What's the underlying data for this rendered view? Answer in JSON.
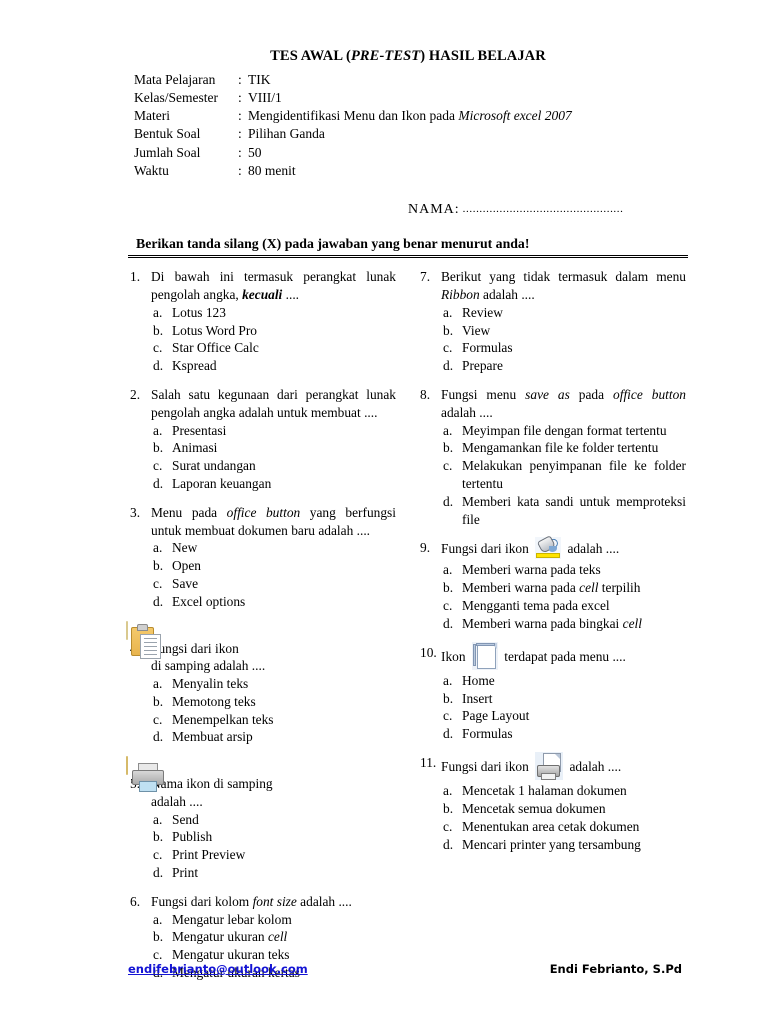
{
  "document": {
    "title_main": "TES AWAL (",
    "title_italic": "PRE-TEST",
    "title_end": ") HASIL BELAJAR",
    "meta": [
      {
        "label": "Mata Pelajaran",
        "colon": ":",
        "value": "TIK",
        "value_italic": ""
      },
      {
        "label": "Kelas/Semester",
        "colon": ":",
        "value": "VIII/1",
        "value_italic": ""
      },
      {
        "label": "Materi",
        "colon": ":",
        "value": "Mengidentifikasi Menu dan Ikon pada ",
        "value_italic": "Microsoft excel 2007"
      },
      {
        "label": "Bentuk Soal",
        "colon": ":",
        "value": "Pilihan Ganda",
        "value_italic": ""
      },
      {
        "label": "Jumlah Soal",
        "colon": ":",
        "value": "50",
        "value_italic": ""
      },
      {
        "label": "Waktu",
        "colon": ":",
        "value": "80 menit",
        "value_italic": ""
      }
    ],
    "nama_label": "NAMA",
    "nama_dots": "................................................",
    "instruction": "Berikan tanda silang (X) pada jawaban yang benar menurut anda!"
  },
  "left_column": [
    {
      "number": "1.",
      "text_parts": [
        {
          "t": "Di bawah ini termasuk perangkat lunak pengolah angka, ",
          "style": "normal"
        },
        {
          "t": "kecuali",
          "style": "bolditalic"
        },
        {
          "t": " ....",
          "style": "normal"
        }
      ],
      "justify": true,
      "icon": "",
      "options": [
        {
          "letter": "a.",
          "parts": [
            {
              "t": "Lotus 123",
              "style": "normal"
            }
          ]
        },
        {
          "letter": "b.",
          "parts": [
            {
              "t": "Lotus Word Pro",
              "style": "normal"
            }
          ]
        },
        {
          "letter": "c.",
          "parts": [
            {
              "t": "Star Office Calc",
              "style": "normal"
            }
          ]
        },
        {
          "letter": "d.",
          "parts": [
            {
              "t": "Kspread",
              "style": "normal"
            }
          ]
        }
      ]
    },
    {
      "number": "2.",
      "text_parts": [
        {
          "t": "Salah satu kegunaan dari perangkat lunak pengolah angka adalah untuk membuat ....",
          "style": "normal"
        }
      ],
      "justify": true,
      "icon": "",
      "options": [
        {
          "letter": "a.",
          "parts": [
            {
              "t": "Presentasi",
              "style": "normal"
            }
          ]
        },
        {
          "letter": "b.",
          "parts": [
            {
              "t": "Animasi",
              "style": "normal"
            }
          ]
        },
        {
          "letter": "c.",
          "parts": [
            {
              "t": "Surat undangan",
              "style": "normal"
            }
          ]
        },
        {
          "letter": "d.",
          "parts": [
            {
              "t": "Laporan keuangan",
              "style": "normal"
            }
          ]
        }
      ]
    },
    {
      "number": "3.",
      "text_parts": [
        {
          "t": "Menu pada ",
          "style": "normal"
        },
        {
          "t": "office button",
          "style": "italic"
        },
        {
          "t": " yang berfungsi untuk membuat dokumen baru adalah ....",
          "style": "normal"
        }
      ],
      "justify": true,
      "icon": "",
      "options": [
        {
          "letter": "a.",
          "parts": [
            {
              "t": "New",
              "style": "normal"
            }
          ]
        },
        {
          "letter": "b.",
          "parts": [
            {
              "t": "Open",
              "style": "normal"
            }
          ]
        },
        {
          "letter": "c.",
          "parts": [
            {
              "t": "Save",
              "style": "normal"
            }
          ]
        },
        {
          "letter": "d.",
          "parts": [
            {
              "t": "Excel options",
              "style": "normal"
            }
          ]
        }
      ]
    },
    {
      "number": "4.",
      "text_parts": [
        {
          "t": "Fungsi dari ikon",
          "style": "normal"
        },
        {
          "t": "\nBREAK",
          "style": "break"
        },
        {
          "t": "di samping adalah ....",
          "style": "normal"
        }
      ],
      "justify": false,
      "icon": "paste-icon",
      "options": [
        {
          "letter": "a.",
          "parts": [
            {
              "t": "Menyalin teks",
              "style": "normal"
            }
          ]
        },
        {
          "letter": "b.",
          "parts": [
            {
              "t": "Memotong teks",
              "style": "normal"
            }
          ]
        },
        {
          "letter": "c.",
          "parts": [
            {
              "t": "Menempelkan teks",
              "style": "normal"
            }
          ]
        },
        {
          "letter": "d.",
          "parts": [
            {
              "t": "Membuat arsip",
              "style": "normal"
            }
          ]
        }
      ]
    },
    {
      "number": "5.",
      "text_parts": [
        {
          "t": "Nama ikon di samping",
          "style": "normal"
        },
        {
          "t": "\nBREAK",
          "style": "break"
        },
        {
          "t": "adalah ....",
          "style": "normal"
        }
      ],
      "justify": false,
      "icon": "printer-icon",
      "options": [
        {
          "letter": "a.",
          "parts": [
            {
              "t": "Send",
              "style": "normal"
            }
          ]
        },
        {
          "letter": "b.",
          "parts": [
            {
              "t": "Publish",
              "style": "normal"
            }
          ]
        },
        {
          "letter": "c.",
          "parts": [
            {
              "t": "Print Preview",
              "style": "normal"
            }
          ]
        },
        {
          "letter": "d.",
          "parts": [
            {
              "t": "Print",
              "style": "normal"
            }
          ]
        }
      ]
    },
    {
      "number": "6.",
      "text_parts": [
        {
          "t": "Fungsi dari kolom ",
          "style": "normal"
        },
        {
          "t": "font size",
          "style": "italic"
        },
        {
          "t": " adalah ....",
          "style": "normal"
        }
      ],
      "justify": false,
      "icon": "",
      "options": [
        {
          "letter": "a.",
          "parts": [
            {
              "t": "Mengatur lebar kolom",
              "style": "normal"
            }
          ]
        },
        {
          "letter": "b.",
          "parts": [
            {
              "t": "Mengatur ukuran ",
              "style": "normal"
            },
            {
              "t": "cell",
              "style": "italic"
            }
          ]
        },
        {
          "letter": "c.",
          "parts": [
            {
              "t": "Mengatur ukuran teks",
              "style": "normal"
            }
          ]
        },
        {
          "letter": "d.",
          "parts": [
            {
              "t": "Mengatur ukuran kertas",
              "style": "normal"
            }
          ]
        }
      ]
    }
  ],
  "right_column": [
    {
      "number": "7.",
      "text_parts": [
        {
          "t": "Berikut yang tidak termasuk dalam menu ",
          "style": "normal"
        },
        {
          "t": "Ribbon",
          "style": "italic"
        },
        {
          "t": " adalah ....",
          "style": "normal"
        }
      ],
      "justify": true,
      "icon": "",
      "options": [
        {
          "letter": "a.",
          "parts": [
            {
              "t": "Review",
              "style": "normal"
            }
          ]
        },
        {
          "letter": "b.",
          "parts": [
            {
              "t": "View",
              "style": "normal"
            }
          ]
        },
        {
          "letter": "c.",
          "parts": [
            {
              "t": "Formulas",
              "style": "normal"
            }
          ]
        },
        {
          "letter": "d.",
          "parts": [
            {
              "t": "Prepare",
              "style": "normal"
            }
          ]
        }
      ]
    },
    {
      "number": "8.",
      "text_parts": [
        {
          "t": "Fungsi menu ",
          "style": "normal"
        },
        {
          "t": "save as",
          "style": "italic"
        },
        {
          "t": " pada ",
          "style": "normal"
        },
        {
          "t": "office button",
          "style": "italic"
        },
        {
          "t": " adalah ....",
          "style": "normal"
        }
      ],
      "justify": true,
      "icon": "",
      "options": [
        {
          "letter": "a.",
          "parts": [
            {
              "t": "Meyimpan file dengan format tertentu",
              "style": "normal"
            }
          ],
          "justify": true
        },
        {
          "letter": "b.",
          "parts": [
            {
              "t": "Mengamankan file ke folder tertentu",
              "style": "normal"
            }
          ],
          "justify": true
        },
        {
          "letter": "c.",
          "parts": [
            {
              "t": "Melakukan penyimpanan file ke folder tertentu",
              "style": "normal"
            }
          ],
          "justify": true
        },
        {
          "letter": "d.",
          "parts": [
            {
              "t": "Memberi kata sandi untuk memproteksi file",
              "style": "normal"
            }
          ],
          "justify": true
        }
      ]
    },
    {
      "number": "9.",
      "text_parts": [
        {
          "t": "Fungsi dari ikon ",
          "style": "normal"
        },
        {
          "t": "ICON",
          "style": "icon",
          "icon": "fill-color-icon"
        },
        {
          "t": " adalah ....",
          "style": "normal"
        }
      ],
      "justify": false,
      "icon": "",
      "options": [
        {
          "letter": "a.",
          "parts": [
            {
              "t": "Memberi warna pada teks",
              "style": "normal"
            }
          ]
        },
        {
          "letter": "b.",
          "parts": [
            {
              "t": "Memberi warna pada ",
              "style": "normal"
            },
            {
              "t": "cell",
              "style": "italic"
            },
            {
              "t": " terpilih",
              "style": "normal"
            }
          ]
        },
        {
          "letter": "c.",
          "parts": [
            {
              "t": "Mengganti tema pada excel",
              "style": "normal"
            }
          ]
        },
        {
          "letter": "d.",
          "parts": [
            {
              "t": "Memberi warna pada bingkai ",
              "style": "normal"
            },
            {
              "t": "cell",
              "style": "italic"
            }
          ]
        }
      ]
    },
    {
      "number": "10.",
      "text_parts": [
        {
          "t": "Ikon ",
          "style": "normal"
        },
        {
          "t": "ICON",
          "style": "icon",
          "icon": "blank-page-icon"
        },
        {
          "t": " terdapat pada menu ....",
          "style": "normal"
        }
      ],
      "justify": false,
      "icon": "",
      "options": [
        {
          "letter": "a.",
          "parts": [
            {
              "t": "Home",
              "style": "normal"
            }
          ]
        },
        {
          "letter": "b.",
          "parts": [
            {
              "t": "Insert",
              "style": "normal"
            }
          ]
        },
        {
          "letter": "c.",
          "parts": [
            {
              "t": "Page Layout",
              "style": "normal"
            }
          ]
        },
        {
          "letter": "d.",
          "parts": [
            {
              "t": "Formulas",
              "style": "normal"
            }
          ]
        }
      ]
    },
    {
      "number": "11.",
      "text_parts": [
        {
          "t": "Fungsi dari ikon ",
          "style": "normal"
        },
        {
          "t": "ICON",
          "style": "icon",
          "icon": "print-preview-icon"
        },
        {
          "t": " adalah ....",
          "style": "normal"
        }
      ],
      "justify": false,
      "icon": "",
      "options": [
        {
          "letter": "a.",
          "parts": [
            {
              "t": "Mencetak 1 halaman dokumen",
              "style": "normal"
            }
          ]
        },
        {
          "letter": "b.",
          "parts": [
            {
              "t": "Mencetak semua dokumen",
              "style": "normal"
            }
          ]
        },
        {
          "letter": "c.",
          "parts": [
            {
              "t": "Menentukan area cetak dokumen",
              "style": "normal"
            }
          ]
        },
        {
          "letter": "d.",
          "parts": [
            {
              "t": "Mencari printer yang tersambung",
              "style": "normal"
            }
          ]
        }
      ]
    }
  ],
  "footer": {
    "email": "endifebrianto@outlook.com",
    "author": "Endi Febrianto, S.Pd",
    "email_color": "#1414d4"
  }
}
